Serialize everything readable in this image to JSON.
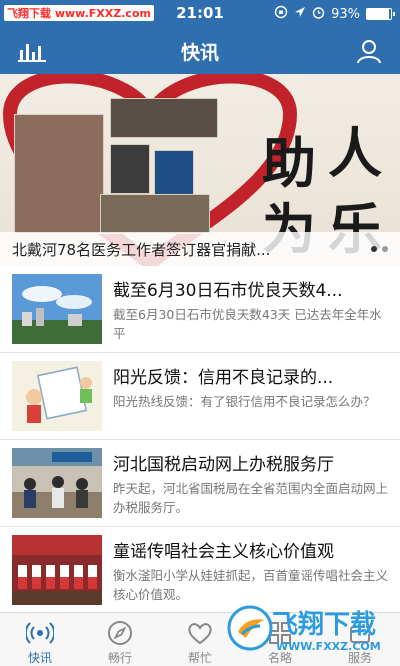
{
  "status_bar": {
    "watermark": "飞翔下载 www.FXXZ.com",
    "time": "21:01",
    "battery_percent": "93%",
    "battery_level": 0.93
  },
  "nav": {
    "title": "快讯",
    "left_icon": "bar-chart-icon",
    "right_icon": "user-icon",
    "bg_color": "#2f6fb0"
  },
  "banner": {
    "caption": "北戴河78名医务工作者签订器官捐献...",
    "big_text_1": "助",
    "big_text_2": "人",
    "big_text_3": "为",
    "big_text_4": "乐",
    "dot_count": 2,
    "active_dot": 0
  },
  "news": [
    {
      "title": "截至6月30日石市优良天数4...",
      "desc": "截至6月30日石市优良天数43天 已达去年全年水平",
      "thumb": "city-sky-photo"
    },
    {
      "title": "阳光反馈：信用不良记录的...",
      "desc": "阳光热线反馈：有了银行信用不良记录怎么办？",
      "thumb": "cartoon-illustration"
    },
    {
      "title": "河北国税启动网上办税服务厅",
      "desc": "昨天起，河北省国税局在全省范围内全面启动网上办税服务厅。",
      "thumb": "office-hall-photo"
    },
    {
      "title": "童谣传唱社会主义核心价值观",
      "desc": "衡水滏阳小学从娃娃抓起，百首童谣传唱社会主义核心价值观。",
      "thumb": "children-performance-photo"
    }
  ],
  "tabs": [
    {
      "label": "快讯",
      "icon": "broadcast-icon",
      "active": true
    },
    {
      "label": "畅行",
      "icon": "compass-icon",
      "active": false
    },
    {
      "label": "帮忙",
      "icon": "heart-hands-icon",
      "active": false
    },
    {
      "label": "名略",
      "icon": "grid-icon",
      "active": false
    },
    {
      "label": "服务",
      "icon": "service-icon",
      "active": false
    }
  ],
  "watermark_br": {
    "main": "飞翔下载",
    "sub": "WWW.FXXZ.COM"
  }
}
